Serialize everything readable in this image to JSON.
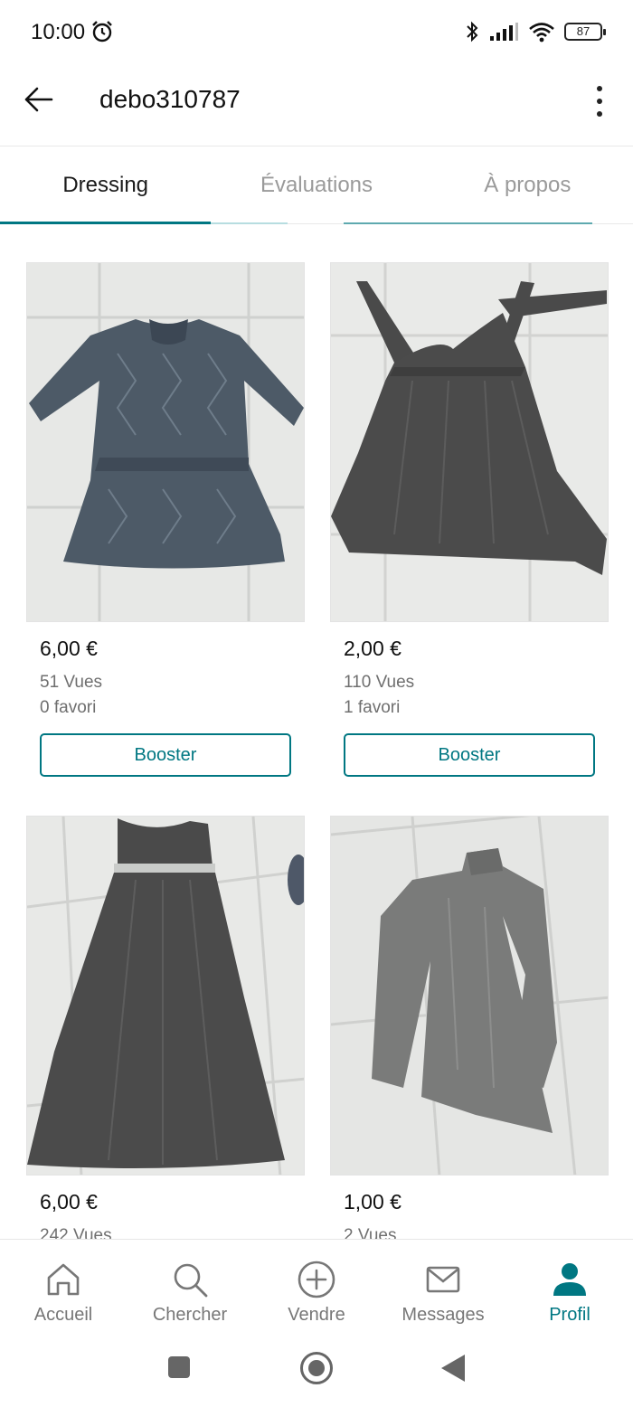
{
  "status_bar": {
    "time": "10:00",
    "battery": "87"
  },
  "header": {
    "title": "debo310787"
  },
  "tabs": [
    {
      "label": "Dressing",
      "active": true
    },
    {
      "label": "Évaluations",
      "active": false
    },
    {
      "label": "À propos",
      "active": false
    }
  ],
  "items": [
    {
      "price": "6,00 €",
      "views": "51 Vues",
      "favorites": "0 favori",
      "button": "Booster",
      "photo": "blue patterned dress"
    },
    {
      "price": "2,00 €",
      "views": "110 Vues",
      "favorites": "1 favori",
      "button": "Booster",
      "photo": "dark grey halter dress"
    },
    {
      "price": "6,00 €",
      "views": "242 Vues",
      "photo": "long grey maxi dress"
    },
    {
      "price": "1,00 €",
      "views": "2 Vues",
      "photo": "grey turtleneck top"
    }
  ],
  "bottom_nav": [
    {
      "label": "Accueil",
      "icon": "home-icon",
      "active": false
    },
    {
      "label": "Chercher",
      "icon": "search-icon",
      "active": false
    },
    {
      "label": "Vendre",
      "icon": "plus-circle-icon",
      "active": false
    },
    {
      "label": "Messages",
      "icon": "mail-icon",
      "active": false
    },
    {
      "label": "Profil",
      "icon": "person-icon",
      "active": true
    }
  ],
  "colors": {
    "accent": "#007782",
    "text_secondary": "#6f6f6f",
    "tab_inactive": "#9a9a9a"
  }
}
